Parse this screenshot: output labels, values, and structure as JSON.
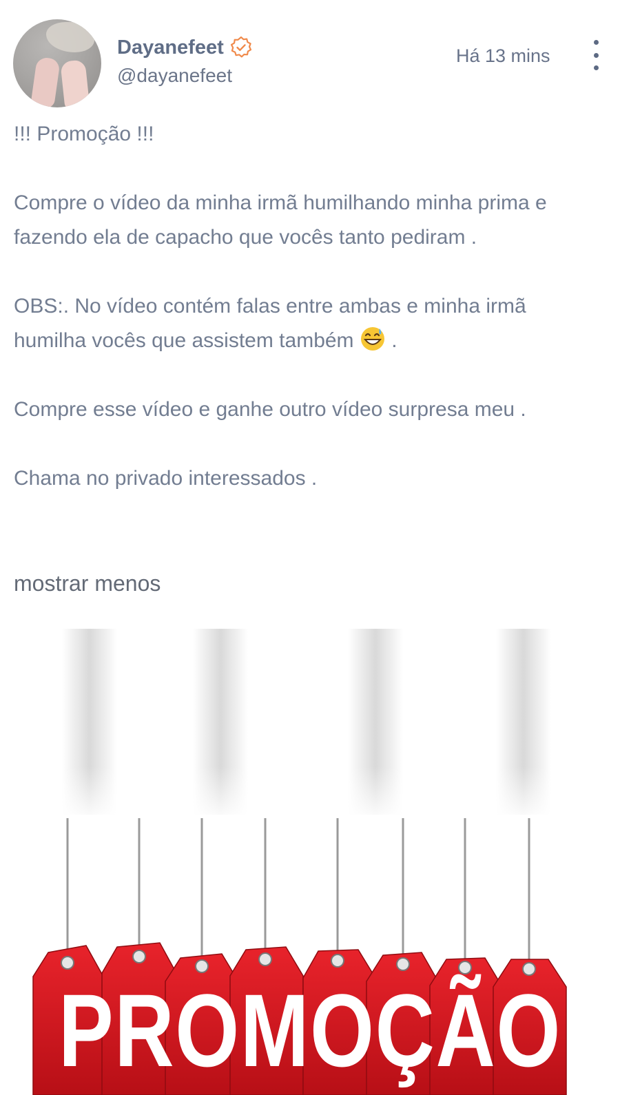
{
  "post": {
    "author": {
      "display_name": "Dayanefeet",
      "handle": "@dayanefeet",
      "verified": true,
      "verified_badge_icon": "verified-badge-icon"
    },
    "timestamp": "Há 13 mins",
    "menu_icon": "more-vertical-icon",
    "text": {
      "line1": "!!! Promoção !!!",
      "paragraph1": "Compre o vídeo da minha irmã humilhando minha prima e fazendo ela de capacho que vocês tanto pediram .",
      "paragraph2_before_emoji": "OBS:. No vídeo contém falas entre ambas e minha irmã humilha vocês que assistem também ",
      "paragraph2_emoji": "sweat-smile-emoji",
      "paragraph2_after_emoji": " .",
      "paragraph3": "Compre esse vídeo e ganhe outro vídeo surpresa meu .",
      "paragraph4": "Chama no privado interessados ."
    },
    "toggle_label": "mostrar menos",
    "media": {
      "banner_text": "PROMOÇÃO",
      "tag_color": "#d8141c",
      "text_color": "#ffffff"
    }
  },
  "colors": {
    "name": "#5f6d86",
    "body_text": "#727d91",
    "badge": "#f08a4b"
  }
}
